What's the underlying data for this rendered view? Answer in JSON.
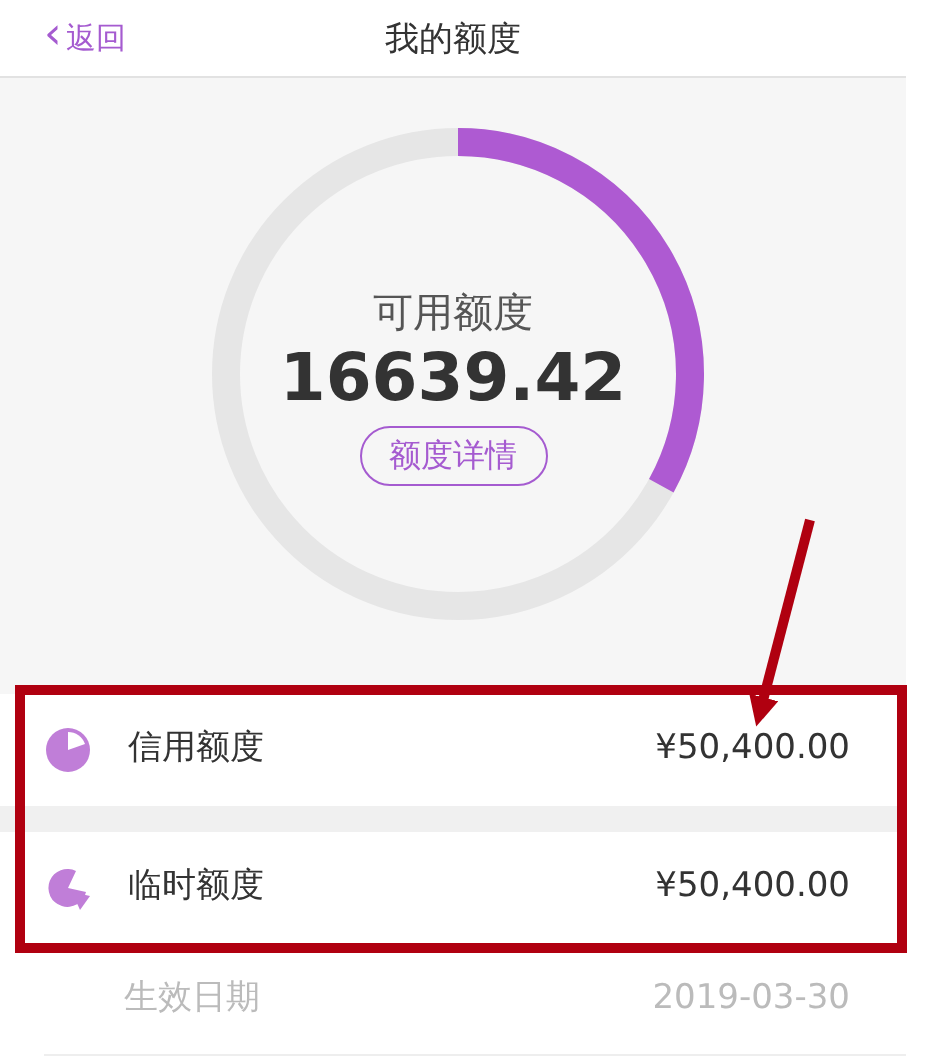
{
  "nav": {
    "back_icon": "‹",
    "back": "返回",
    "title": "我的额度"
  },
  "summary": {
    "label": "可用额度",
    "amount": "16639.42",
    "button": "额度详情"
  },
  "rows": [
    {
      "kind": "credit",
      "label": "信用额度",
      "value": "¥50,400.00"
    },
    {
      "kind": "temporary",
      "label": "临时额度",
      "value": "¥50,400.00"
    },
    {
      "kind": "plain",
      "label": "生效日期",
      "value": "2019-03-30"
    }
  ]
}
